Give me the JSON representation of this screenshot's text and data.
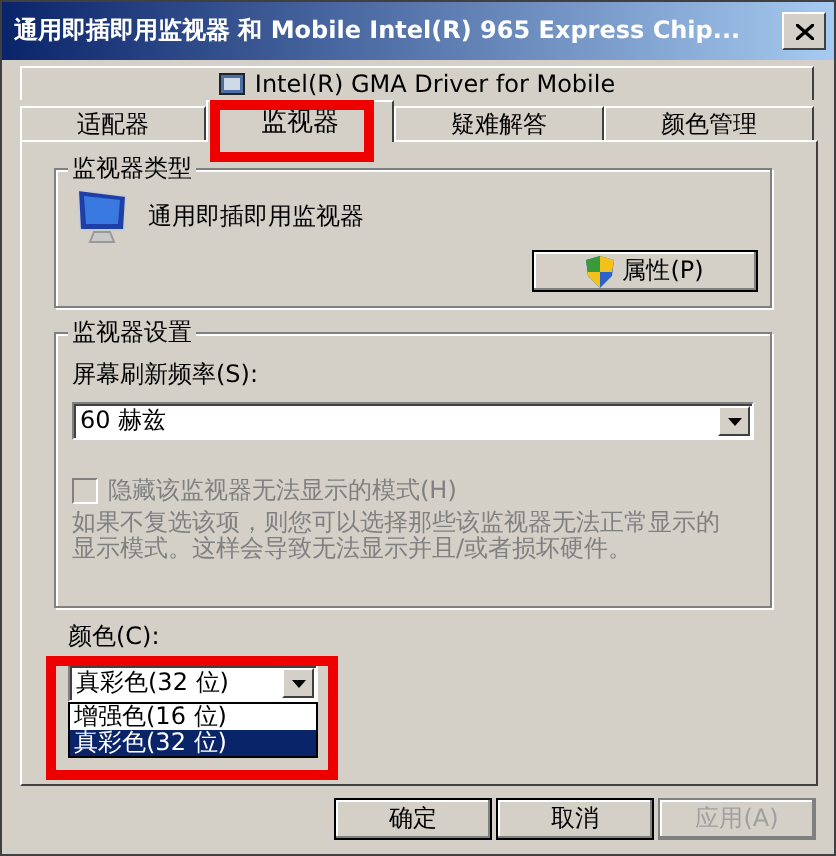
{
  "window": {
    "title": "通用即插即用监视器 和 Mobile Intel(R) 965 Express Chip..."
  },
  "tab_rows": [
    [
      {
        "label": "Intel(R) GMA Driver for Mobile",
        "kind": "driver",
        "selected": false
      }
    ],
    [
      {
        "label": "适配器",
        "kind": "plain",
        "selected": false
      },
      {
        "label": "监视器",
        "kind": "plain",
        "selected": true
      },
      {
        "label": "疑难解答",
        "kind": "plain",
        "selected": false
      },
      {
        "label": "颜色管理",
        "kind": "plain",
        "selected": false
      }
    ]
  ],
  "monitor_type": {
    "title": "监视器类型",
    "name": "通用即插即用监视器",
    "button": "属性(P)"
  },
  "monitor_settings": {
    "title": "监视器设置",
    "refresh_label": "屏幕刷新频率(S):",
    "refresh_value": "60 赫兹",
    "hide_modes": {
      "label": "隐藏该监视器无法显示的模式(H)",
      "checked": false,
      "disabled": true
    },
    "note": "如果不复选该项，则您可以选择那些该监视器无法正常显示的显示模式。这样会导致无法显示并且/或者损坏硬件。",
    "note_disabled": true
  },
  "color": {
    "label": "颜色(C):",
    "value": "真彩色(32 位)",
    "expanded": true,
    "options": [
      {
        "label": "增强色(16 位)",
        "selected": false
      },
      {
        "label": "真彩色(32 位)",
        "selected": true
      }
    ]
  },
  "buttons": [
    {
      "label": "确定",
      "disabled": false
    },
    {
      "label": "取消",
      "disabled": false
    },
    {
      "label": "应用(A)",
      "disabled": true
    }
  ]
}
